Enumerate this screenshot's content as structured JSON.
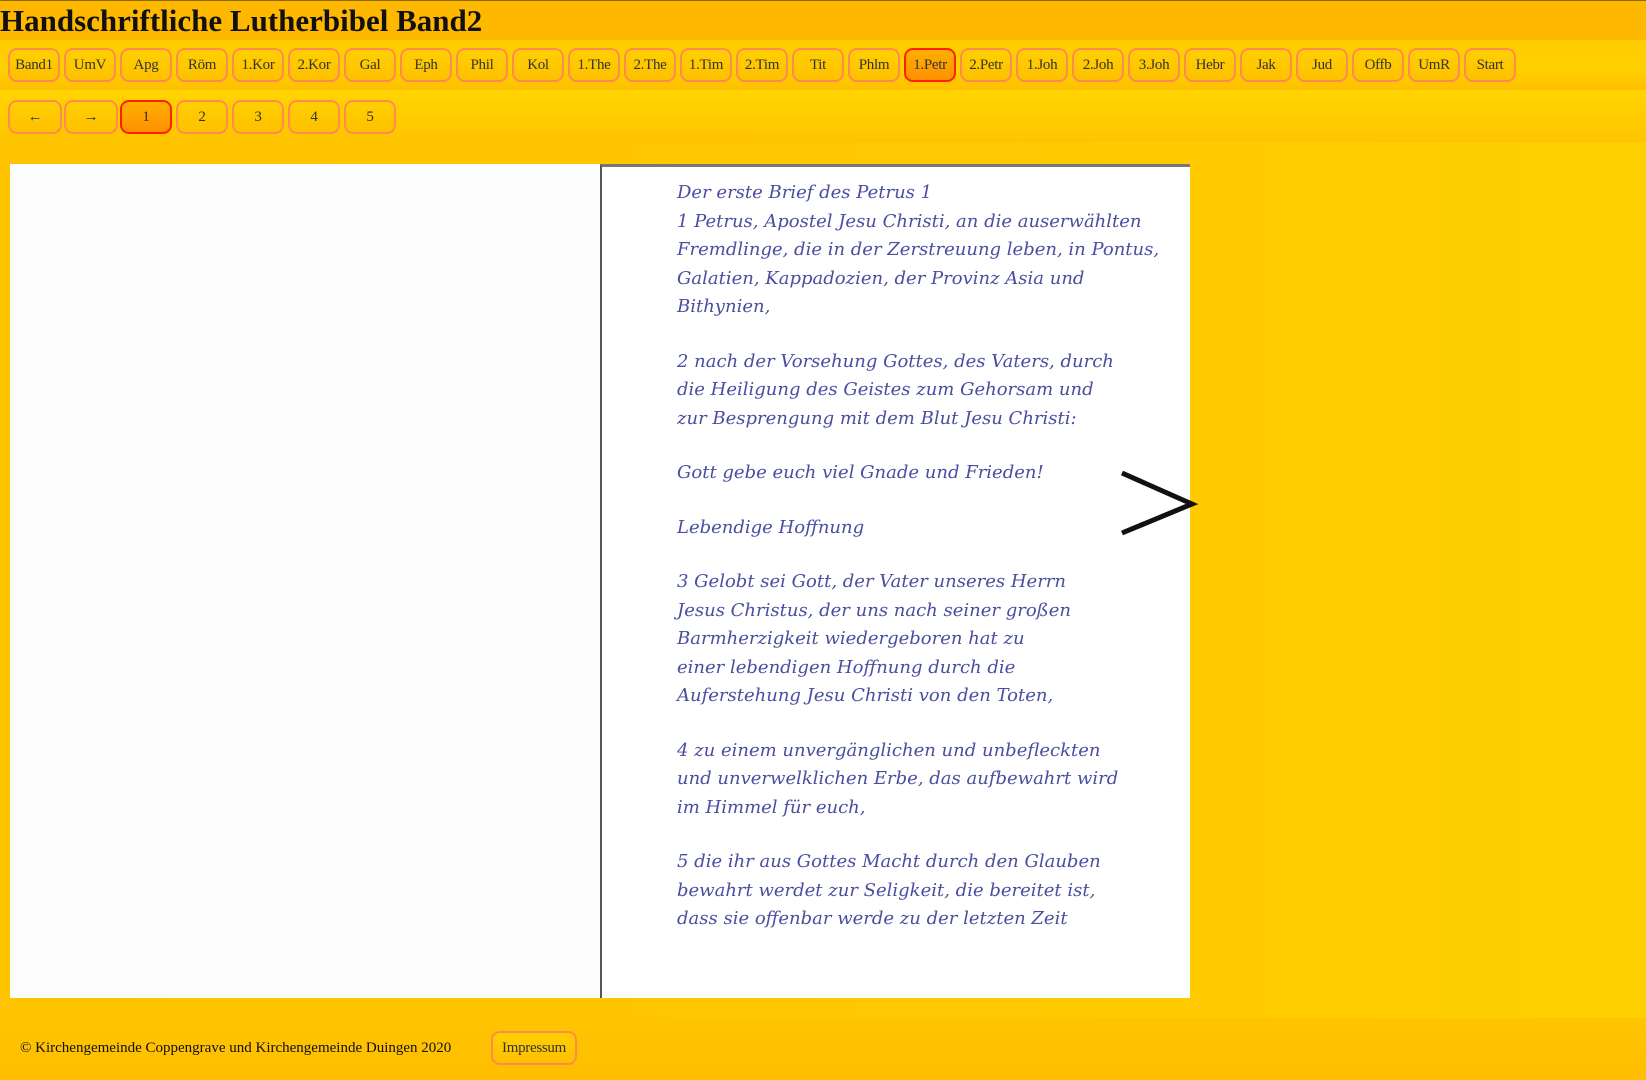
{
  "header": {
    "title": "Handschriftliche Lutherbibel Band2"
  },
  "books": {
    "active": "1.Petr",
    "items": [
      "Band1",
      "UmV",
      "Apg",
      "Röm",
      "1.Kor",
      "2.Kor",
      "Gal",
      "Eph",
      "Phil",
      "Kol",
      "1.The",
      "2.The",
      "1.Tim",
      "2.Tim",
      "Tit",
      "Phlm",
      "1.Petr",
      "2.Petr",
      "1.Joh",
      "2.Joh",
      "3.Joh",
      "Hebr",
      "Jak",
      "Jud",
      "Offb",
      "UmR",
      "Start"
    ]
  },
  "pager": {
    "prev": "←",
    "next": "→",
    "active": "1",
    "pages": [
      "1",
      "2",
      "3",
      "4",
      "5"
    ]
  },
  "page": {
    "lines": [
      "Der erste Brief des Petrus 1",
      "1 Petrus, Apostel Jesu Christi, an die auserwählten",
      "Fremdlinge, die in der Zerstreuung leben, in Pontus,",
      "Galatien, Kappadozien, der Provinz Asia und",
      "Bithynien,",
      "",
      "2 nach der Vorsehung Gottes, des Vaters, durch",
      "die Heiligung des Geistes zum Gehorsam und",
      "zur Besprengung mit dem Blut Jesu Christi:",
      "",
      "Gott gebe euch viel Gnade und Frieden!",
      "",
      "Lebendige Hoffnung",
      "",
      "3 Gelobt sei Gott, der Vater unseres Herrn",
      "Jesus Christus, der uns nach seiner großen",
      "Barmherzigkeit wiedergeboren hat zu",
      "einer lebendigen Hoffnung durch die",
      "Auferstehung Jesu Christi von den Toten,",
      "",
      "4 zu einem unvergänglichen und unbefleckten",
      "und unverwelklichen Erbe, das aufbewahrt wird",
      "im Himmel für euch,",
      "",
      "5 die ihr aus Gottes Macht durch den Glauben",
      "bewahrt werdet zur Seligkeit, die bereitet ist,",
      "dass sie offenbar werde zu der letzten Zeit"
    ],
    "next_icon": "chevron-right-icon"
  },
  "footer": {
    "copyright": "© Kirchengemeinde Coppengrave und Kirchengemeinde Duingen 2020",
    "impressum": "Impressum"
  },
  "colors": {
    "background": "#ffc400",
    "button_border": "#ff8a50",
    "active_border": "#ff2000",
    "ink": "#4a4ea0"
  }
}
